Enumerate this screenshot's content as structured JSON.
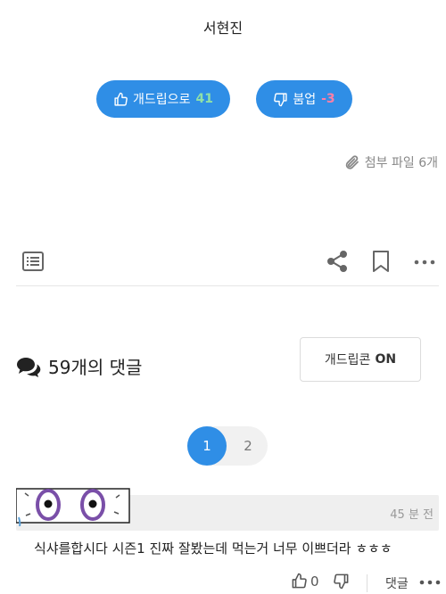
{
  "post": {
    "author": "서현진"
  },
  "votes": {
    "up_label": "개드립으로",
    "up_count": "41",
    "down_label": "붐업",
    "down_count": "-3"
  },
  "attachment": {
    "label": "첨부 파일 6개"
  },
  "comments": {
    "count_label": "59개의 댓글",
    "emoticon_label": "개드립콘",
    "emoticon_state": "ON",
    "pages": [
      "1",
      "2"
    ],
    "current_page": "1",
    "items": [
      {
        "time": "45 분 전",
        "text": "식샤를합시다 시즌1 진짜 잘봤는데 먹는거 너무 이쁘더라 ㅎㅎㅎ",
        "likes": "0",
        "reply_label": "댓글"
      }
    ]
  },
  "colors": {
    "accent": "#2f8ee6",
    "up_count": "#8fe0a8",
    "down_count": "#ff7fa6"
  },
  "icons": [
    "thumbs-up-icon",
    "thumbs-down-icon",
    "paperclip-icon",
    "list-icon",
    "share-icon",
    "bookmark-icon",
    "more-icon",
    "comments-icon"
  ]
}
